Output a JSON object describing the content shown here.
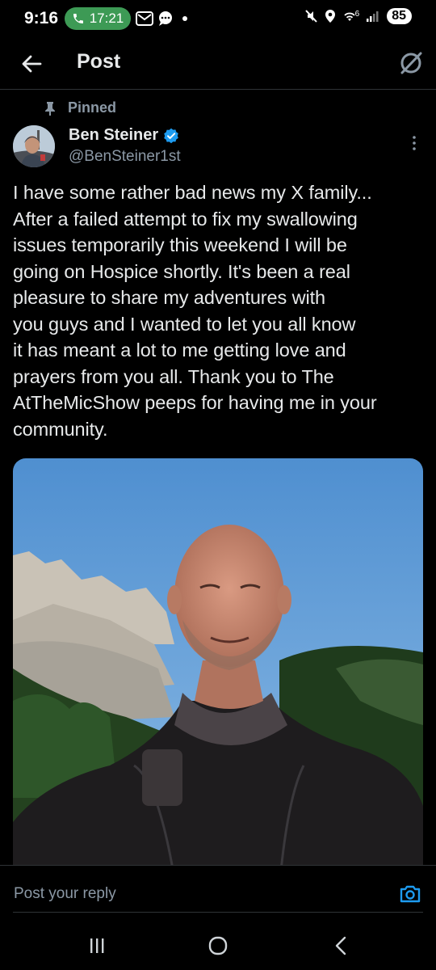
{
  "status_bar": {
    "time": "9:16",
    "call_time": "17:21",
    "network": "6",
    "battery": "85"
  },
  "header": {
    "title": "Post",
    "back_icon": "arrow-left-icon",
    "grok_icon": "grok-icon"
  },
  "tweet": {
    "pinned_label": "Pinned",
    "display_name": "Ben Steiner",
    "verified": true,
    "handle": "@BenSteiner1st",
    "text": "I have some rather bad news my X family...\nAfter a failed attempt to fix my swallowing\nissues temporarily this weekend I will be\ngoing on Hospice shortly. It's been a real\npleasure to share my adventures with\nyou guys and I wanted to let you all know\nit has meant a lot to me getting love and\nprayers from you all. Thank you to The\nAtTheMicShow peeps for having me in your\ncommunity."
  },
  "reply": {
    "placeholder": "Post your reply"
  },
  "colors": {
    "background": "#000000",
    "text_primary": "#e7e9ea",
    "text_secondary": "#8b98a5",
    "verified_blue": "#1d9bf0",
    "divider": "#2f3336",
    "call_green": "#3d9a55"
  }
}
